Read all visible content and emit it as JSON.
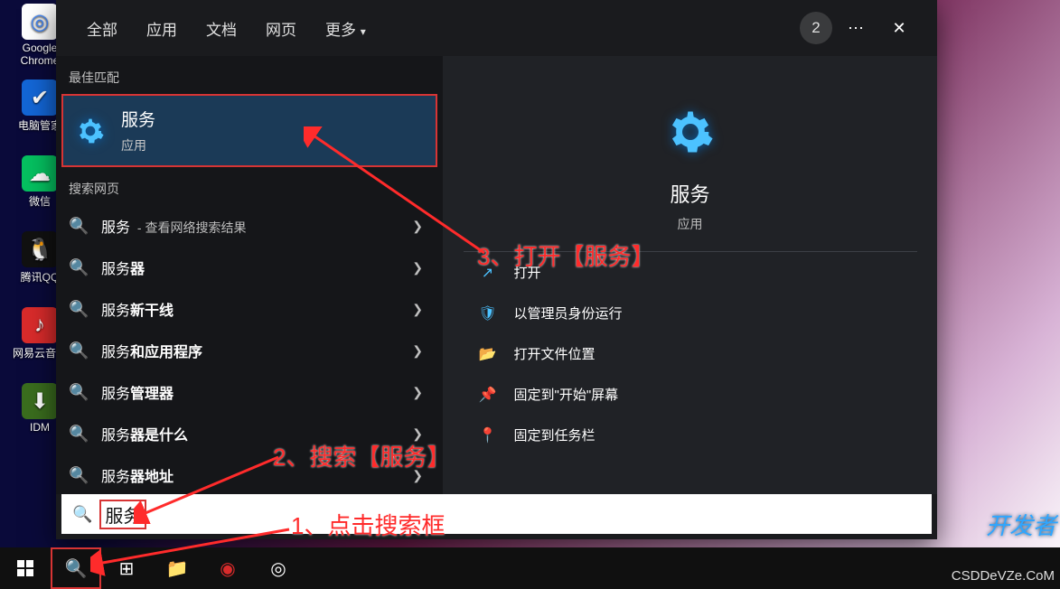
{
  "desktop": {
    "icons": [
      {
        "label": "Google Chrome",
        "bg": "#ffffff",
        "glyph": "◎",
        "color": "#4285f4"
      },
      {
        "label": "电脑管家",
        "bg": "#1366d6",
        "glyph": "✔",
        "color": "#fff"
      },
      {
        "label": "微信",
        "bg": "#05c160",
        "glyph": "☁",
        "color": "#fff"
      },
      {
        "label": "腾讯QQ",
        "bg": "#111",
        "glyph": "🐧",
        "color": "#fff"
      },
      {
        "label": "网易云音乐",
        "bg": "#d92b2b",
        "glyph": "♪",
        "color": "#fff"
      },
      {
        "label": "IDM",
        "bg": "#3a6d1e",
        "glyph": "⬇",
        "color": "#fff"
      }
    ]
  },
  "panel": {
    "tabs": {
      "all": "全部",
      "apps": "应用",
      "docs": "文档",
      "web": "网页",
      "more": "更多"
    },
    "badge_count": "2",
    "section_best": "最佳匹配",
    "section_web": "搜索网页",
    "best": {
      "title": "服务",
      "subtitle": "应用"
    },
    "rows": [
      {
        "prefix": "服务",
        "bold": "",
        "suffix": "",
        "sub": "- 查看网络搜索结果"
      },
      {
        "prefix": "服务",
        "bold": "器",
        "suffix": "",
        "sub": ""
      },
      {
        "prefix": "服务",
        "bold": "新干线",
        "suffix": "",
        "sub": ""
      },
      {
        "prefix": "服务",
        "bold": "和应用程序",
        "suffix": "",
        "sub": ""
      },
      {
        "prefix": "服务",
        "bold": "管理器",
        "suffix": "",
        "sub": ""
      },
      {
        "prefix": "服务",
        "bold": "器是什么",
        "suffix": "",
        "sub": ""
      },
      {
        "prefix": "服务",
        "bold": "器地址",
        "suffix": "",
        "sub": ""
      }
    ],
    "preview": {
      "title": "服务",
      "subtitle": "应用",
      "actions": [
        {
          "icon": "↗",
          "label": "打开"
        },
        {
          "icon": "🛡",
          "label": "以管理员身份运行"
        },
        {
          "icon": "📂",
          "label": "打开文件位置"
        },
        {
          "icon": "📌",
          "label": "固定到\"开始\"屏幕"
        },
        {
          "icon": "📍",
          "label": "固定到任务栏"
        }
      ]
    },
    "search_value": "服务"
  },
  "annotations": {
    "a1": "1、点击搜索框",
    "a2": "2、搜索【服务】",
    "a3": "3、打开【服务】"
  },
  "watermark1": "开发者",
  "watermark2": "CSDDeVZe.CoM"
}
